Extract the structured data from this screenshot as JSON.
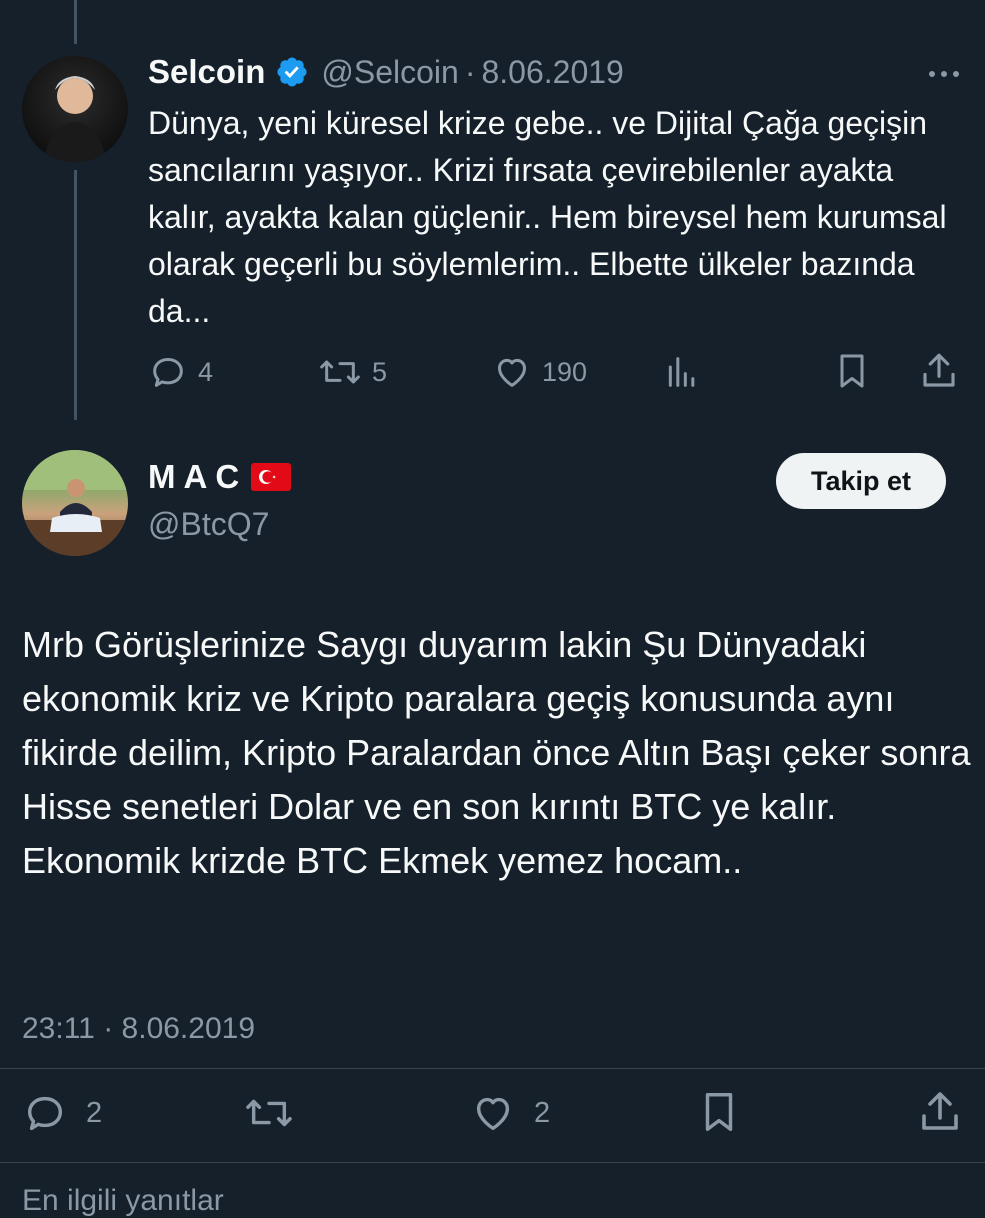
{
  "colors": {
    "background": "#15202b",
    "text_primary": "#f7f9f9",
    "text_secondary": "#8b98a5",
    "verified_blue": "#1d9bf0",
    "follow_button_bg": "#eff3f4",
    "follow_button_text": "#0f1419"
  },
  "parent_tweet": {
    "author_name": "Selcoin",
    "verified": true,
    "handle": "@Selcoin",
    "separator": "·",
    "date": "8.06.2019",
    "text": "Dünya, yeni küresel krize gebe.. ve Dijital Çağa geçişin sancılarını yaşıyor.. Krizi fırsata çevirebilenler ayakta kalır, ayakta kalan güçlenir.. Hem bireysel hem kurumsal olarak geçerli bu söylemlerim.. Elbette ülkeler bazında da...",
    "actions": {
      "replies": "4",
      "retweets": "5",
      "likes": "190"
    },
    "icons": [
      "more-icon",
      "reply-icon",
      "retweet-icon",
      "like-icon",
      "views-icon",
      "bookmark-icon",
      "share-icon"
    ]
  },
  "reply_tweet": {
    "author_name": "MAC",
    "flag": "Turkey flag",
    "handle": "@BtcQ7",
    "follow_label": "Takip et",
    "text": "Mrb Görüşlerinize Saygı duyarım lakin Şu Dünyadaki ekonomik kriz ve Kripto paralara geçiş konusunda aynı fikirde deilim, Kripto Paralardan önce Altın Başı çeker sonra Hisse senetleri Dolar ve en son kırıntı BTC ye kalır. Ekonomik krizde BTC Ekmek yemez hocam..",
    "time": "23:11",
    "separator": "·",
    "date": "8.06.2019",
    "actions": {
      "replies": "2",
      "likes": "2"
    },
    "icons": [
      "reply-icon",
      "retweet-icon",
      "like-icon",
      "bookmark-icon",
      "share-icon"
    ]
  },
  "bottom_partial_text": "En ilgili yanıtlar"
}
